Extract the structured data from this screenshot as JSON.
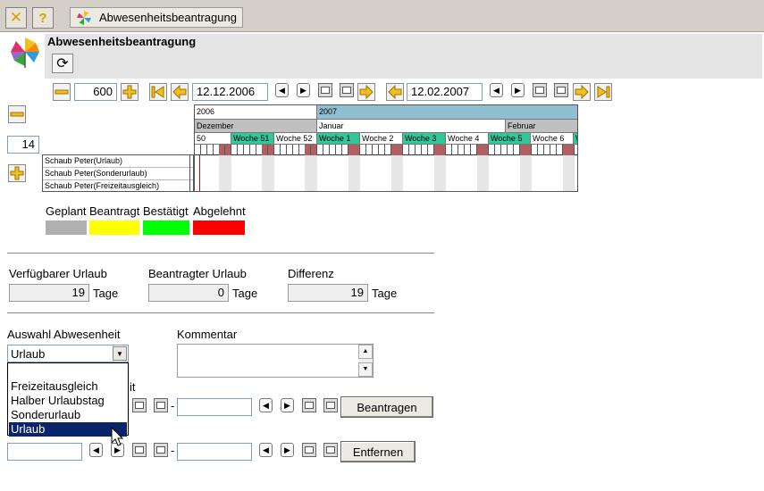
{
  "toolbar": {
    "tab_title": "Abwesenheitsbeantragung",
    "close_icon": "close-icon",
    "help_icon": "help-icon"
  },
  "header": {
    "title": "Abwesenheitsbeantragung"
  },
  "nav": {
    "zoom_value": "600",
    "start_date": "12.12.2006",
    "end_date": "12.02.2007",
    "rows_value": "14"
  },
  "timeline": {
    "years": [
      "2006",
      "2007"
    ],
    "months": [
      "Dezember",
      "Januar",
      "Februar"
    ],
    "weeks": [
      "50",
      "Woche 51",
      "Woche 52",
      "Woche 1",
      "Woche 2",
      "Woche 3",
      "Woche 4",
      "Woche 5",
      "Woche 6",
      "W"
    ],
    "rows": [
      "Schaub Peter(Urlaub)",
      "Schaub Peter(Sonderurlaub)",
      "Schaub Peter(Freizeitausgleich)"
    ],
    "colors": {
      "year_2007": "#8fbfd0",
      "week_highlight": "#2fc79b",
      "weekend": "#b06060"
    }
  },
  "legend": {
    "items": [
      {
        "label": "Geplant",
        "color": "#b0b0b0"
      },
      {
        "label": "Beantragt",
        "color": "#ffff00"
      },
      {
        "label": "Bestätigt",
        "color": "#00ff00"
      },
      {
        "label": "Abgelehnt",
        "color": "#ff0000"
      }
    ]
  },
  "summary": {
    "available_label": "Verfügbarer Urlaub",
    "available_value": "19",
    "available_unit": "Tage",
    "requested_label": "Beantragter Urlaub",
    "requested_value": "0",
    "requested_unit": "Tage",
    "difference_label": "Differenz",
    "difference_value": "19",
    "difference_unit": "Tage"
  },
  "form": {
    "absence_label": "Auswahl Abwesenheit",
    "absence_selected": "Urlaub",
    "absence_options": [
      "Freizeitausgleich",
      "Halber Urlaubstag",
      "Sonderurlaub",
      "Urlaub"
    ],
    "comment_label": "Kommentar",
    "partial_label": "it",
    "dash": "-",
    "request_button": "Beantragen",
    "remove_button": "Entfernen"
  }
}
